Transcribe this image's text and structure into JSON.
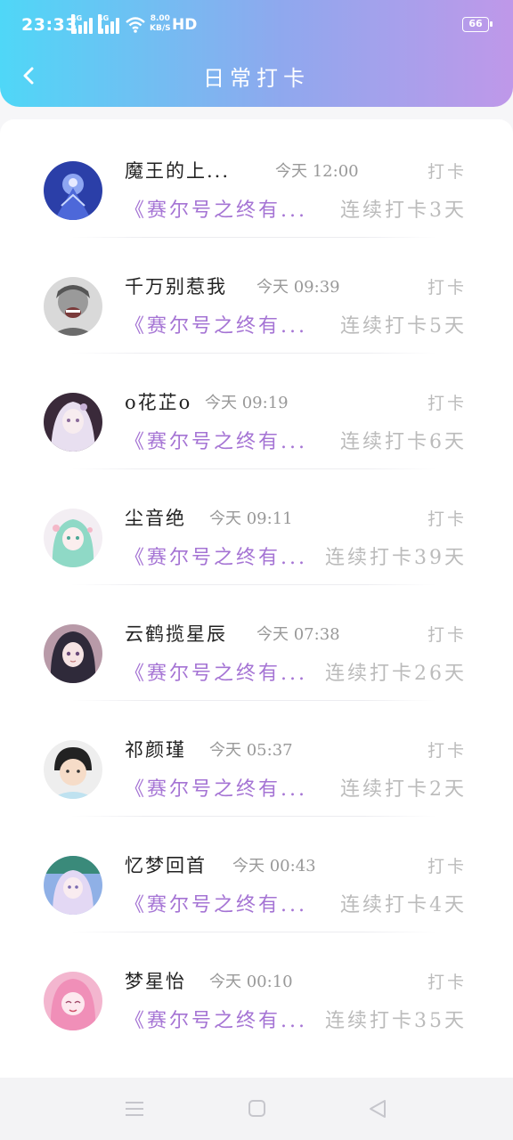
{
  "status_bar": {
    "time": "23:33",
    "network_1": "4G",
    "network_2": "4G",
    "speed_value": "8.00",
    "speed_unit": "KB/S",
    "hd_label": "HD",
    "battery": "66"
  },
  "header": {
    "title": "日常打卡"
  },
  "checkins": [
    {
      "name": "魔王的上...",
      "time": "今天 12:00",
      "action": "打卡",
      "book": "《赛尔号之终有...",
      "streak": "连续打卡3天"
    },
    {
      "name": "千万别惹我",
      "time": "今天 09:39",
      "action": "打卡",
      "book": "《赛尔号之终有...",
      "streak": "连续打卡5天"
    },
    {
      "name": "o花芷o",
      "time": "今天 09:19",
      "action": "打卡",
      "book": "《赛尔号之终有...",
      "streak": "连续打卡6天"
    },
    {
      "name": "尘音绝",
      "time": "今天 09:11",
      "action": "打卡",
      "book": "《赛尔号之终有...",
      "streak": "连续打卡39天"
    },
    {
      "name": "云鹤揽星辰",
      "time": "今天 07:38",
      "action": "打卡",
      "book": "《赛尔号之终有...",
      "streak": "连续打卡26天"
    },
    {
      "name": "祁颜瑾",
      "time": "今天 05:37",
      "action": "打卡",
      "book": "《赛尔号之终有...",
      "streak": "连续打卡2天"
    },
    {
      "name": "忆梦回首",
      "time": "今天 00:43",
      "action": "打卡",
      "book": "《赛尔号之终有...",
      "streak": "连续打卡4天"
    },
    {
      "name": "梦星怡",
      "time": "今天 00:10",
      "action": "打卡",
      "book": "《赛尔号之终有...",
      "streak": "连续打卡35天"
    }
  ],
  "nav_icons": [
    "menu-icon",
    "home-icon",
    "back-triangle-icon"
  ]
}
